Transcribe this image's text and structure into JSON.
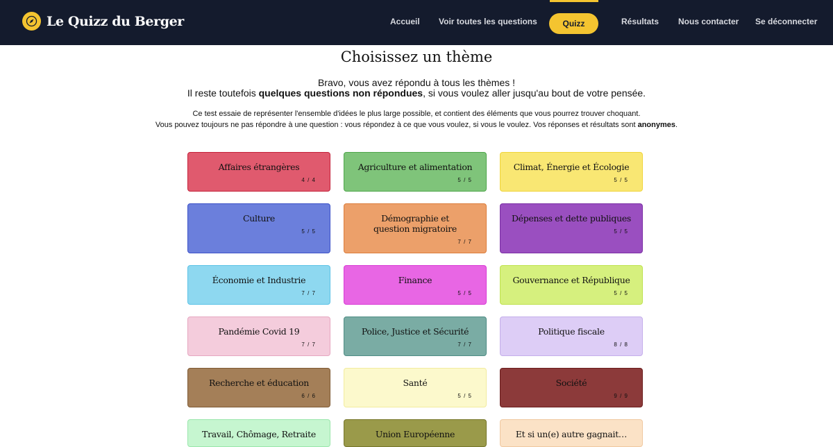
{
  "brand": {
    "title": "Le Quizz du Berger",
    "icon": "compass-icon",
    "accent": "#f4c430"
  },
  "nav": {
    "accueil": "Accueil",
    "questions": "Voir toutes les questions",
    "quizz": "Quizz",
    "resultats": "Résultats",
    "contact": "Nous contacter",
    "logout": "Se déconnecter"
  },
  "page": {
    "title": "Choisissez un thème",
    "intro_line1": "Bravo, vous avez répondu à tous les thèmes !",
    "intro_line2_pre": "Il reste toutefois ",
    "intro_line2_bold": "quelques questions non répondues",
    "intro_line2_post": ", si vous voulez aller jusqu'au bout de votre pensée.",
    "intro_line3": "Ce test essaie de représenter l'ensemble d'idées le plus large possible, et contient des éléments que vous pourrez trouver choquant.",
    "intro_line4_pre": "Vous pouvez toujours ne pas répondre à une question : vous répondez à ce que vous voulez, si vous le voulez. Vos réponses et résultats sont ",
    "intro_line4_bold": "anonymes",
    "intro_line4_post": "."
  },
  "themes": [
    {
      "label": "Affaires étrangères",
      "count": "4 / 4",
      "bg": "#e05a6e",
      "border": "#c4223a",
      "text": "#111"
    },
    {
      "label": "Agriculture et alimentation",
      "count": "5 / 5",
      "bg": "#7fc47a",
      "border": "#4ea64a",
      "text": "#111"
    },
    {
      "label": "Climat, Énergie et Écologie",
      "count": "5 / 5",
      "bg": "#f9e773",
      "border": "#f0d43a",
      "text": "#111"
    },
    {
      "label": "Culture",
      "count": "5 / 5",
      "bg": "#6b7fdc",
      "border": "#3c52c8",
      "text": "#111"
    },
    {
      "label": "Démographie et question migratoire",
      "count": "7 / 7",
      "bg": "#eca06a",
      "border": "#dc7d3c",
      "text": "#111"
    },
    {
      "label": "Dépenses et dette publiques",
      "count": "5 / 5",
      "bg": "#9a4fc0",
      "border": "#7a2ea4",
      "text": "#111"
    },
    {
      "label": "Économie et Industrie",
      "count": "7 / 7",
      "bg": "#8ed8f0",
      "border": "#5cc2e6",
      "text": "#111"
    },
    {
      "label": "Finance",
      "count": "5 / 5",
      "bg": "#e866e4",
      "border": "#d83ad4",
      "text": "#111"
    },
    {
      "label": "Gouvernance et République",
      "count": "5 / 5",
      "bg": "#d6f07e",
      "border": "#bfe24e",
      "text": "#111"
    },
    {
      "label": "Pandémie Covid 19",
      "count": "7 / 7",
      "bg": "#f4ccdc",
      "border": "#e6a6c0",
      "text": "#111"
    },
    {
      "label": "Police, Justice et Sécurité",
      "count": "7 / 7",
      "bg": "#7aaca4",
      "border": "#4e8c84",
      "text": "#111"
    },
    {
      "label": "Politique fiscale",
      "count": "8 / 8",
      "bg": "#ddcdf6",
      "border": "#c4aeea",
      "text": "#111"
    },
    {
      "label": "Recherche et éducation",
      "count": "6 / 6",
      "bg": "#a47f58",
      "border": "#7e5a34",
      "text": "#111"
    },
    {
      "label": "Santé",
      "count": "5 / 5",
      "bg": "#fcf9cc",
      "border": "#f2ec9e",
      "text": "#111"
    },
    {
      "label": "Société",
      "count": "9 / 9",
      "bg": "#8c3a3a",
      "border": "#6a1c1c",
      "text": "#111"
    },
    {
      "label": "Travail, Chômage, Retraite",
      "count": "",
      "bg": "#c6f6d0",
      "border": "#9ae6ac",
      "text": "#111"
    },
    {
      "label": "Union Européenne",
      "count": "",
      "bg": "#9a9a4a",
      "border": "#76762a",
      "text": "#111"
    },
    {
      "label": "Et si un(e) autre gagnait…",
      "count": "",
      "bg": "#fbe2c6",
      "border": "#f0c8a0",
      "text": "#111"
    }
  ]
}
